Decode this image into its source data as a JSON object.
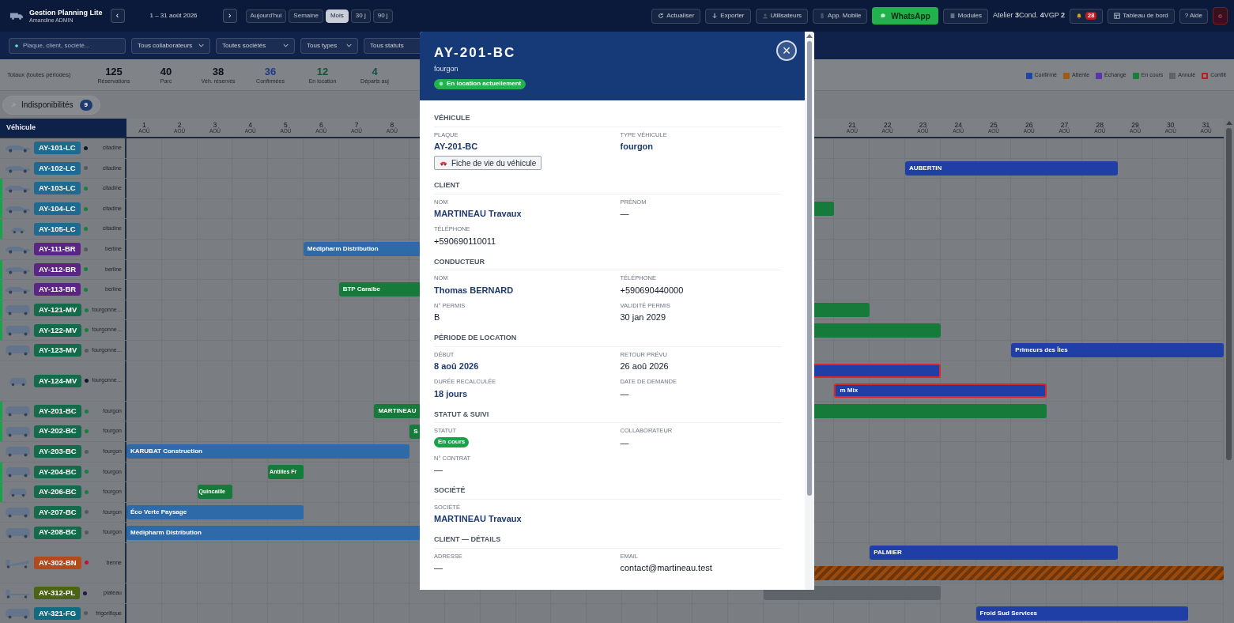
{
  "topbar": {
    "app_title": "Gestion Planning Lite",
    "user": "Amandine ADMIN",
    "prev": "‹",
    "period": "1 – 31 août 2026",
    "next": "›",
    "views": [
      {
        "label": "Aujourd'hui",
        "selected": false
      },
      {
        "label": "Semaine",
        "selected": false
      },
      {
        "label": "Mois",
        "selected": true
      },
      {
        "label": "30 j",
        "selected": false
      },
      {
        "label": "90 j",
        "selected": false
      }
    ],
    "actions": [
      {
        "kind": "refresh",
        "label": "Actualiser"
      },
      {
        "kind": "export",
        "label": "Exporter"
      },
      {
        "kind": "users",
        "label": "Utilisateurs"
      },
      {
        "kind": "mobile",
        "label": "App. Mobile"
      },
      {
        "kind": "whatsapp",
        "label": "WhatsApp"
      },
      {
        "kind": "modules",
        "label": "Modules"
      }
    ],
    "counters": "Atelier **3**Cond. **4**VGP **2**",
    "notifications": "28",
    "dashboard": "Tableau de bord",
    "help": "? Aide"
  },
  "filters": {
    "search": {
      "placeholder": "Plaque, client, société..."
    },
    "selects": [
      "Tous collaborateurs",
      "Toutes sociétés",
      "Tous types",
      "Tous statuts"
    ]
  },
  "totals": {
    "label": "Totaux (toutes périodes)",
    "stats": [
      {
        "value": "125",
        "label": "Réservations",
        "kind": "default"
      },
      {
        "value": "40",
        "label": "Parc",
        "kind": "default"
      },
      {
        "value": "38",
        "label": "Véh. réservés",
        "kind": "default"
      },
      {
        "value": "36",
        "label": "Confirmées",
        "kind": "blue"
      },
      {
        "value": "12",
        "label": "En location",
        "kind": "green"
      },
      {
        "value": "4",
        "label": "Départs auj",
        "kind": "teal"
      }
    ]
  },
  "legend": [
    {
      "label": "Confirmé",
      "color": "#1f45a8",
      "kind": "fill"
    },
    {
      "label": "Attente",
      "color": "#a05a16",
      "kind": "fill"
    },
    {
      "label": "Échange",
      "color": "#5b34a8",
      "kind": "fill"
    },
    {
      "label": "En cours",
      "color": "#16803a",
      "kind": "fill"
    },
    {
      "label": "Annulé",
      "color": "#5f636a",
      "kind": "fill"
    },
    {
      "label": "Conflit",
      "color": "#b91c1c",
      "kind": "outline"
    }
  ],
  "unavailability": {
    "label": "Indisponibilités",
    "count": "9"
  },
  "gantt": {
    "vehicle_header": "Véhicule",
    "days": [
      {
        "day": "1",
        "month": "AOÛ"
      },
      {
        "day": "2",
        "month": "AOÛ"
      },
      {
        "day": "3",
        "month": "AOÛ"
      },
      {
        "day": "4",
        "month": "AOÛ"
      },
      {
        "day": "5",
        "month": "AOÛ"
      },
      {
        "day": "6",
        "month": "AOÛ"
      },
      {
        "day": "7",
        "month": "AOÛ"
      },
      {
        "day": "8",
        "month": "AOÛ"
      },
      {
        "day": "21",
        "month": "AOÛ"
      },
      {
        "day": "22",
        "month": "AOÛ"
      },
      {
        "day": "23",
        "month": "AOÛ"
      },
      {
        "day": "24",
        "month": "AOÛ"
      },
      {
        "day": "25",
        "month": "AOÛ"
      },
      {
        "day": "26",
        "month": "AOÛ"
      },
      {
        "day": "27",
        "month": "AOÛ"
      },
      {
        "day": "28",
        "month": "AOÛ"
      },
      {
        "day": "29",
        "month": "AOÛ"
      },
      {
        "day": "30",
        "month": "AOÛ"
      },
      {
        "day": "31",
        "month": "AOÛ"
      }
    ],
    "vehicles": [
      {
        "plate": {
          "label": "AY-101-LC",
          "color": "#1f6a91"
        },
        "kind": "car",
        "dot": {
          "color": "#111827"
        },
        "type": "citadine",
        "active": false
      },
      {
        "plate": {
          "label": "AY-102-LC",
          "color": "#1f6a91"
        },
        "kind": "car",
        "dot": {
          "color": "#55595f"
        },
        "type": "citadine",
        "active": false,
        "lanes": [
          [
            {
              "label": "AUBERTIN",
              "color": "#1f3fa6",
              "conflict": false,
              "striped": false
            }
          ]
        ]
      },
      {
        "plate": {
          "label": "AY-103-LC",
          "color": "#1f6a91"
        },
        "kind": "car",
        "dot": {
          "color": "#15803d"
        },
        "type": "citadine",
        "active": true
      },
      {
        "plate": {
          "label": "AY-104-LC",
          "color": "#1f6a91"
        },
        "kind": "car",
        "dot": {
          "color": "#15803d"
        },
        "type": "citadine",
        "active": true,
        "lanes": [
          [
            {
              "color": "#167a3a",
              "conflict": false,
              "striped": false
            }
          ]
        ]
      },
      {
        "plate": {
          "label": "AY-105-LC",
          "color": "#1f6a91"
        },
        "kind": "small-car",
        "dot": {
          "color": "#15803d"
        },
        "type": "citadine",
        "active": true
      },
      {
        "plate": {
          "label": "AY-111-BR",
          "color": "#5b2585"
        },
        "kind": "car",
        "dot": {
          "color": "#55595f"
        },
        "type": "berline",
        "active": false,
        "lanes": [
          [
            {
              "label": "Médipharm Distribution",
              "color": "#2f6aa8",
              "conflict": false,
              "striped": false
            }
          ]
        ]
      },
      {
        "plate": {
          "label": "AY-112-BR",
          "color": "#5b2585"
        },
        "kind": "car",
        "dot": {
          "color": "#15803d"
        },
        "type": "berline",
        "active": true
      },
      {
        "plate": {
          "label": "AY-113-BR",
          "color": "#5b2585"
        },
        "kind": "car",
        "dot": {
          "color": "#15803d"
        },
        "type": "berline",
        "active": true,
        "lanes": [
          [
            {
              "label": "BTP Caraibe",
              "color": "#167a3a",
              "conflict": false,
              "striped": false
            }
          ]
        ]
      },
      {
        "plate": {
          "label": "AY-121-MV",
          "color": "#136b4c"
        },
        "kind": "van",
        "dot": {
          "color": "#15803d"
        },
        "type": "fourgonne…",
        "active": true,
        "lanes": [
          [
            {
              "color": "#167a3a",
              "conflict": false,
              "striped": false
            }
          ]
        ]
      },
      {
        "plate": {
          "label": "AY-122-MV",
          "color": "#136b4c"
        },
        "kind": "van",
        "dot": {
          "color": "#15803d"
        },
        "type": "fourgonne…",
        "active": true,
        "lanes": [
          [
            {
              "color": "#167a3a",
              "conflict": false,
              "striped": false
            }
          ]
        ]
      },
      {
        "plate": {
          "label": "AY-123-MV",
          "color": "#136b4c"
        },
        "kind": "van",
        "dot": {
          "color": "#55595f"
        },
        "type": "fourgonne…",
        "active": false,
        "lanes": [
          [
            {
              "label": "Primeurs des Îles",
              "color": "#1f3fa6",
              "conflict": false,
              "striped": false
            }
          ]
        ]
      },
      {
        "plate": {
          "label": "AY-124-MV",
          "color": "#136b4c"
        },
        "kind": "small-van",
        "dot": {
          "color": "#111827"
        },
        "type": "fourgonne…",
        "active": false,
        "lanes": [
          [
            {
              "color": "#1f3fa6",
              "conflict": true,
              "striped": false
            }
          ],
          [
            {
              "label": "m Mix",
              "color": "#1f3fa6",
              "conflict": true,
              "striped": false
            }
          ]
        ]
      },
      {
        "plate": {
          "label": "AY-201-BC",
          "color": "#136b4c"
        },
        "kind": "van",
        "dot": {
          "color": "#15803d"
        },
        "type": "fourgon",
        "active": true,
        "lanes": [
          [
            {
              "label": "MARTINEAU",
              "color": "#167a3a",
              "conflict": false,
              "striped": false
            }
          ]
        ]
      },
      {
        "plate": {
          "label": "AY-202-BC",
          "color": "#136b4c"
        },
        "kind": "van",
        "dot": {
          "color": "#15803d"
        },
        "type": "fourgon",
        "active": true,
        "lanes": [
          [
            {
              "label": "S",
              "color": "#167a3a",
              "conflict": false,
              "striped": false
            }
          ]
        ]
      },
      {
        "plate": {
          "label": "AY-203-BC",
          "color": "#136b4c"
        },
        "kind": "van",
        "dot": {
          "color": "#55595f"
        },
        "type": "fourgon",
        "active": false,
        "lanes": [
          [
            {
              "label": "KARUBAT Construction",
              "color": "#2f6aa8",
              "conflict": false,
              "striped": false
            }
          ]
        ]
      },
      {
        "plate": {
          "label": "AY-204-BC",
          "color": "#136b4c"
        },
        "kind": "van",
        "dot": {
          "color": "#15803d"
        },
        "type": "fourgon",
        "active": true,
        "lanes": [
          [
            {
              "label": "Antilles Fr",
              "color": "#167a3a",
              "conflict": false,
              "striped": false
            }
          ]
        ]
      },
      {
        "plate": {
          "label": "AY-206-BC",
          "color": "#136b4c"
        },
        "kind": "small-van",
        "dot": {
          "color": "#15803d"
        },
        "type": "fourgon",
        "active": true,
        "lanes": [
          [
            {
              "label": "Quincaille",
              "color": "#167a3a",
              "conflict": false,
              "striped": false
            }
          ]
        ]
      },
      {
        "plate": {
          "label": "AY-207-BC",
          "color": "#136b4c"
        },
        "kind": "van",
        "dot": {
          "color": "#55595f"
        },
        "type": "fourgon",
        "active": false,
        "lanes": [
          [
            {
              "label": "Éco Verte Paysage",
              "color": "#2f6aa8",
              "conflict": false,
              "striped": false
            }
          ]
        ]
      },
      {
        "plate": {
          "label": "AY-208-BC",
          "color": "#136b4c"
        },
        "kind": "van",
        "dot": {
          "color": "#55595f"
        },
        "type": "fourgon",
        "active": false,
        "lanes": [
          [
            {
              "label": "Médipharm Distribution",
              "color": "#2f6aa8",
              "conflict": false,
              "striped": false
            }
          ]
        ]
      },
      {
        "plate": {
          "label": "AY-302-BN",
          "color": "#b24a1c"
        },
        "kind": "tipper",
        "dot": {
          "color": "#be123c"
        },
        "type": "benne",
        "active": false,
        "lanes": [
          [
            {
              "label": "PALMIER",
              "color": "#1f3fa6",
              "conflict": false,
              "striped": false
            }
          ],
          [
            {
              "color": "#9a4a0c",
              "conflict": false,
              "striped": true
            }
          ]
        ]
      },
      {
        "plate": {
          "label": "AY-312-PL",
          "color": "#4a6414"
        },
        "kind": "flatbed",
        "dot": {
          "color": "#1e1b4b"
        },
        "type": "plateau",
        "active": false,
        "lanes": [
          [
            {
              "color": "#5f636a",
              "conflict": false,
              "striped": false
            }
          ]
        ]
      },
      {
        "plate": {
          "label": "AY-321-FG",
          "color": "#136b82"
        },
        "kind": "van",
        "dot": {
          "color": "#55595f"
        },
        "type": "frigorifique",
        "active": false,
        "lanes": [
          [
            {
              "label": "Froid Sud Services",
              "color": "#1f3fa6",
              "conflict": false,
              "striped": false
            }
          ]
        ]
      }
    ]
  },
  "modal": {
    "title": "AY-201-BC",
    "subtitle": "fourgon",
    "status_badge": "En location actuellement",
    "close": "×",
    "sections": [
      {
        "title": "VÉHICULE",
        "fields": [
          {
            "label": "PLAQUE",
            "value": "AY-201-BC",
            "kind": "strong"
          },
          {
            "label": "TYPE VÉHICULE",
            "value": "fourgon",
            "kind": "strong"
          },
          {
            "value": "Fiche de vie du véhicule",
            "kind": "button"
          }
        ]
      },
      {
        "title": "CLIENT",
        "fields": [
          {
            "label": "NOM",
            "value": "MARTINEAU Travaux",
            "kind": "strong"
          },
          {
            "label": "PRÉNOM",
            "value": "—",
            "kind": "plain"
          },
          {
            "label": "TÉLÉPHONE",
            "value": "+590690110011",
            "kind": "plain"
          }
        ]
      },
      {
        "title": "CONDUCTEUR",
        "fields": [
          {
            "label": "NOM",
            "value": "Thomas BERNARD",
            "kind": "strong"
          },
          {
            "label": "TÉLÉPHONE",
            "value": "+590690440000",
            "kind": "plain"
          },
          {
            "label": "N° PERMIS",
            "value": "B",
            "kind": "plain"
          },
          {
            "label": "VALIDITÉ PERMIS",
            "value": "30 jan 2029",
            "kind": "plain"
          }
        ]
      },
      {
        "title": "PÉRIODE DE LOCATION",
        "fields": [
          {
            "label": "DÉBUT",
            "value": "8 aoû 2026",
            "kind": "strong"
          },
          {
            "label": "RETOUR PRÉVU",
            "value": "26 aoû 2026",
            "kind": "plain"
          },
          {
            "label": "DURÉE RECALCULÉE",
            "value": "18 jours",
            "kind": "strong"
          },
          {
            "label": "DATE DE DEMANDE",
            "value": "—",
            "kind": "plain"
          }
        ]
      },
      {
        "title": "STATUT & SUIVI",
        "fields": [
          {
            "label": "STATUT",
            "value": "En cours",
            "kind": "badge"
          },
          {
            "label": "COLLABORATEUR",
            "value": "—",
            "kind": "plain"
          },
          {
            "label": "N° CONTRAT",
            "value": "—",
            "kind": "plain"
          }
        ]
      },
      {
        "title": "SOCIÉTÉ",
        "fields": [
          {
            "label": "SOCIÉTÉ",
            "value": "MARTINEAU Travaux",
            "kind": "strong"
          }
        ]
      },
      {
        "title": "CLIENT — DÉTAILS",
        "fields": [
          {
            "label": "ADRESSE",
            "value": "—",
            "kind": "plain"
          },
          {
            "label": "EMAIL",
            "value": "contact@martineau.test",
            "kind": "plain"
          }
        ]
      }
    ]
  }
}
